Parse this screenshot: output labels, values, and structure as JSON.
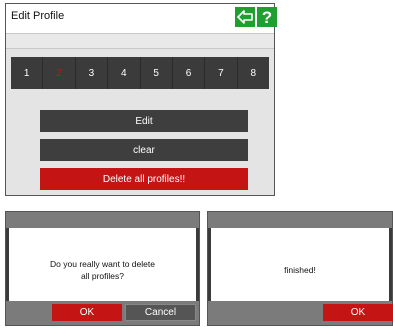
{
  "main_window": {
    "title": "Edit Profile",
    "back_icon": "back-arrow-icon",
    "help_label": "?",
    "profile_slots": [
      "1",
      "2",
      "3",
      "4",
      "5",
      "6",
      "7",
      "8"
    ],
    "selected_slot": "2",
    "edit_label": "Edit",
    "clear_label": "clear",
    "delete_all_label": "Delete all profiles!!"
  },
  "confirm_dialog": {
    "message_line1": "Do you really want to delete",
    "message_line2": "all profiles?",
    "ok_label": "OK",
    "cancel_label": "Cancel"
  },
  "finished_dialog": {
    "message": "finished!",
    "ok_label": "OK"
  },
  "colors": {
    "accent_green": "#1f9f2f",
    "danger_red": "#c41414",
    "dark_gray": "#3e3e3e"
  }
}
